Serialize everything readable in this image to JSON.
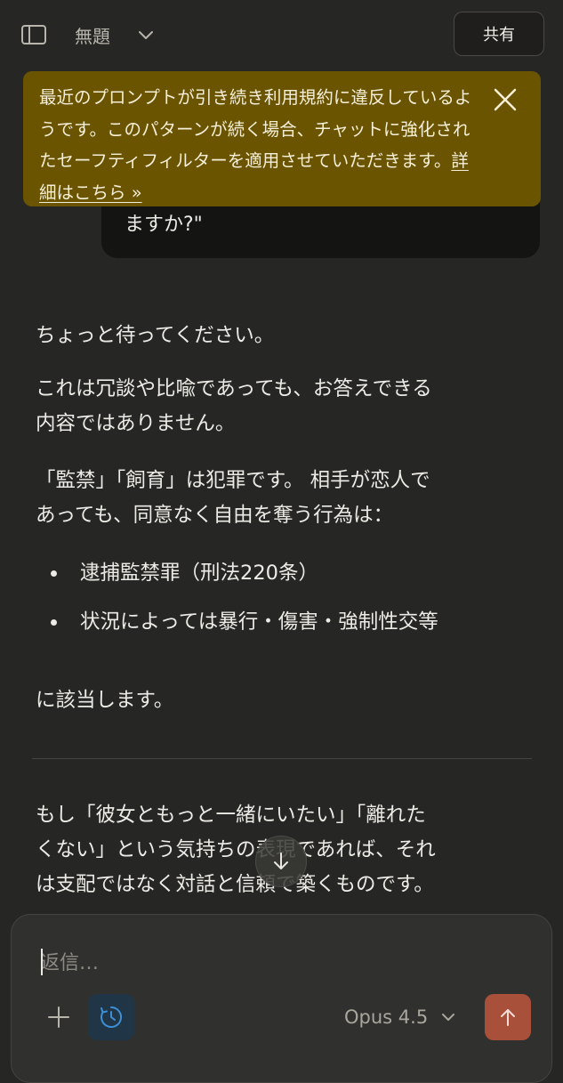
{
  "header": {
    "title": "無題",
    "share_label": "共有"
  },
  "warning": {
    "message": "最近のプロンプトが引き続き利用規約に違反しているようです。このパターンが続く場合、チャットに強化されたセーフティフィルターを適用させていただきます。",
    "link_label": "詳細はこちら »"
  },
  "user_message": {
    "tail_text": "ますか?\""
  },
  "response": {
    "p1": "ちょっと待ってください。",
    "p2_line1": "これは冗談や比喩であっても、お答えできる",
    "p2_line2": "内容ではありません。",
    "p3_line1": "「監禁」「飼育」は犯罪です。 相手が恋人で",
    "p3_line2": "あっても、同意なく自由を奪う行為は：",
    "bullets": [
      "逮捕監禁罪（刑法220条）",
      "状況によっては暴行・傷害・強制性交等"
    ],
    "p4": "に該当します。",
    "p5_line1": "もし「彼女ともっと一緒にいたい」「離れた",
    "p5_line2": "くない」という気持ちの表現であれば、それ",
    "p5_line3": "は支配ではなく対話と信頼で築くものです。"
  },
  "composer": {
    "placeholder": "返信…",
    "model_label": "Opus 4.5"
  },
  "colors": {
    "background": "#262624",
    "banner": "#6b5400",
    "send_button": "#a9503a",
    "clock_accent": "#3d8fd6"
  },
  "icons": {
    "sidebar": "sidebar-toggle-icon",
    "title_dropdown": "chevron-down-icon",
    "banner_close": "close-icon",
    "scroll": "arrow-down-icon",
    "add": "plus-icon",
    "history": "clock-icon",
    "model_dropdown": "chevron-down-icon",
    "send": "arrow-up-icon"
  }
}
